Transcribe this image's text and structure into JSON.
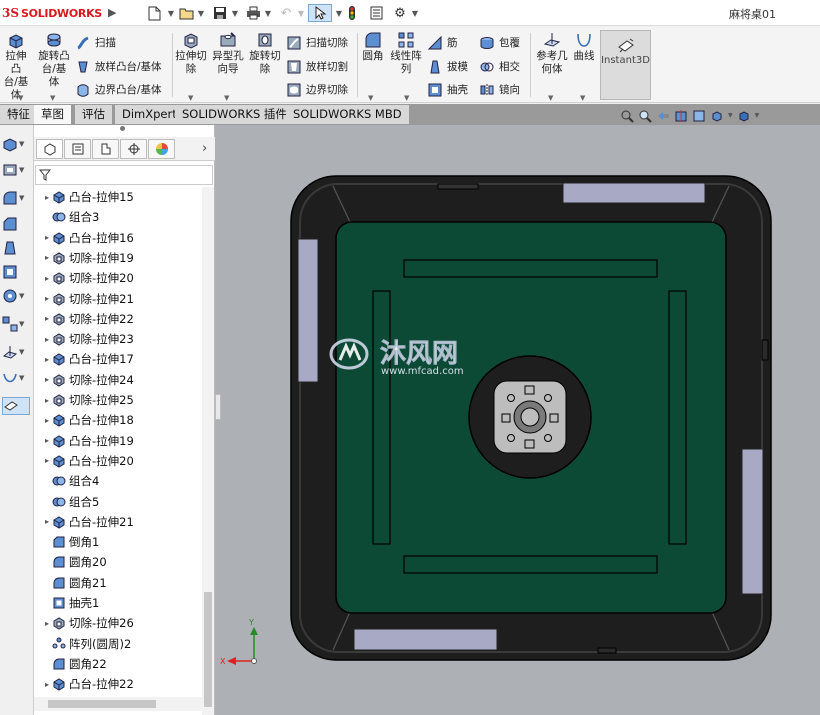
{
  "app": {
    "logo_prefix": "3S",
    "logo_text": "SOLIDWORKS",
    "document_title": "麻将桌01"
  },
  "command_manager": {
    "extrude_boss": "拉伸凸\n台/基\n体",
    "revolve_boss": "旋转凸\n台/基\n体",
    "sweep": "扫描",
    "loft": "放样凸台/基体",
    "boundary_boss": "边界凸台/基体",
    "extrude_cut": "拉伸切\n除",
    "hole_wizard": "异型孔\n向导",
    "revolve_cut": "旋转切\n除",
    "swept_cut": "扫描切除",
    "lofted_cut": "放样切割",
    "boundary_cut": "边界切除",
    "fillet": "圆角",
    "linear_pattern": "线性阵\n列",
    "rib": "筋",
    "draft": "拔模",
    "shell": "抽壳",
    "wrap": "包覆",
    "intersect": "相交",
    "mirror": "镜向",
    "ref_geometry": "参考几\n何体",
    "curves": "曲线",
    "instant3d": "Instant3D"
  },
  "tabs": [
    "特征",
    "草图",
    "评估",
    "DimXpert",
    "SOLIDWORKS 插件",
    "SOLIDWORKS MBD"
  ],
  "feature_tree": [
    {
      "label": "凸台-拉伸15",
      "type": "boss",
      "expandable": true
    },
    {
      "label": "组合3",
      "type": "combine",
      "expandable": false
    },
    {
      "label": "凸台-拉伸16",
      "type": "boss",
      "expandable": true
    },
    {
      "label": "切除-拉伸19",
      "type": "cut",
      "expandable": true
    },
    {
      "label": "切除-拉伸20",
      "type": "cut",
      "expandable": true
    },
    {
      "label": "切除-拉伸21",
      "type": "cut",
      "expandable": true
    },
    {
      "label": "切除-拉伸22",
      "type": "cut",
      "expandable": true
    },
    {
      "label": "切除-拉伸23",
      "type": "cut",
      "expandable": true
    },
    {
      "label": "凸台-拉伸17",
      "type": "boss",
      "expandable": true
    },
    {
      "label": "切除-拉伸24",
      "type": "cut",
      "expandable": true
    },
    {
      "label": "切除-拉伸25",
      "type": "cut",
      "expandable": true
    },
    {
      "label": "凸台-拉伸18",
      "type": "boss",
      "expandable": true
    },
    {
      "label": "凸台-拉伸19",
      "type": "boss",
      "expandable": true
    },
    {
      "label": "凸台-拉伸20",
      "type": "boss",
      "expandable": true
    },
    {
      "label": "组合4",
      "type": "combine",
      "expandable": false
    },
    {
      "label": "组合5",
      "type": "combine",
      "expandable": false
    },
    {
      "label": "凸台-拉伸21",
      "type": "boss",
      "expandable": true
    },
    {
      "label": "倒角1",
      "type": "chamfer",
      "expandable": false
    },
    {
      "label": "圆角20",
      "type": "fillet",
      "expandable": false
    },
    {
      "label": "圆角21",
      "type": "fillet",
      "expandable": false
    },
    {
      "label": "抽壳1",
      "type": "shell",
      "expandable": false
    },
    {
      "label": "切除-拉伸26",
      "type": "cut",
      "expandable": true
    },
    {
      "label": "阵列(圆周)2",
      "type": "pattern",
      "expandable": false
    },
    {
      "label": "圆角22",
      "type": "fillet",
      "expandable": false
    },
    {
      "label": "凸台-拉伸22",
      "type": "boss",
      "expandable": true
    }
  ],
  "watermark": {
    "brand": "沐风网",
    "url": "www.mfcad.com"
  },
  "triad": {
    "x_label": "X",
    "y_label": "Y"
  },
  "colors": {
    "table_felt": "#0c4a36",
    "frame": "#1e1e1e",
    "panel": "#a8a9c4",
    "background": "#adb0b4",
    "logo_red": "#d71920",
    "accent_blue": "#7aa7d6"
  }
}
